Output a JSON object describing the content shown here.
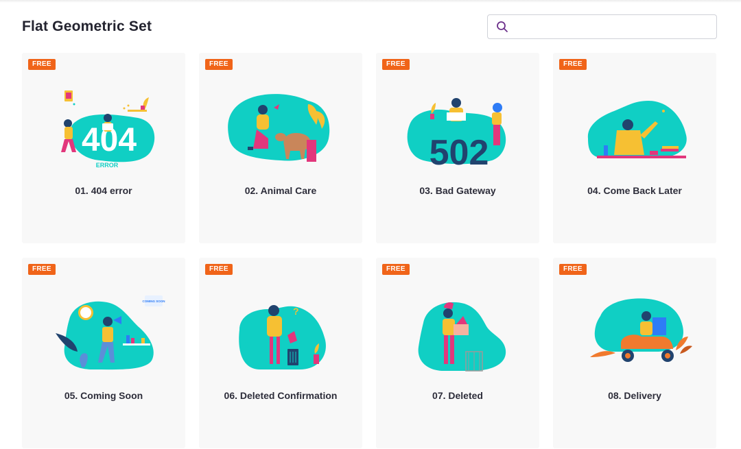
{
  "page": {
    "title": "Flat Geometric Set"
  },
  "search": {
    "value": "",
    "placeholder": ""
  },
  "colors": {
    "accent": "#10CFC4",
    "badge": "#F06419",
    "navy": "#21436E",
    "pink": "#E2377C",
    "yellow": "#F6C033",
    "blue": "#2E7CF6"
  },
  "cards": [
    {
      "badge": "FREE",
      "name": "01. 404 error",
      "icon": "404-error-illustration"
    },
    {
      "badge": "FREE",
      "name": "02. Animal Care",
      "icon": "animal-care-illustration"
    },
    {
      "badge": "FREE",
      "name": "03. Bad Gateway",
      "icon": "bad-gateway-illustration"
    },
    {
      "badge": "FREE",
      "name": "04. Come Back Later",
      "icon": "come-back-later-illustration"
    },
    {
      "badge": "FREE",
      "name": "05. Coming Soon",
      "icon": "coming-soon-illustration"
    },
    {
      "badge": "FREE",
      "name": "06. Deleted Confirmation",
      "icon": "deleted-confirmation-illustration"
    },
    {
      "badge": "FREE",
      "name": "07. Deleted",
      "icon": "deleted-illustration"
    },
    {
      "badge": "FREE",
      "name": "08. Delivery",
      "icon": "delivery-illustration"
    }
  ],
  "illustration_text": {
    "card1_big": "404",
    "card1_small": "ERROR",
    "card3_big": "502",
    "card5_bubble": "COMING SOON"
  }
}
